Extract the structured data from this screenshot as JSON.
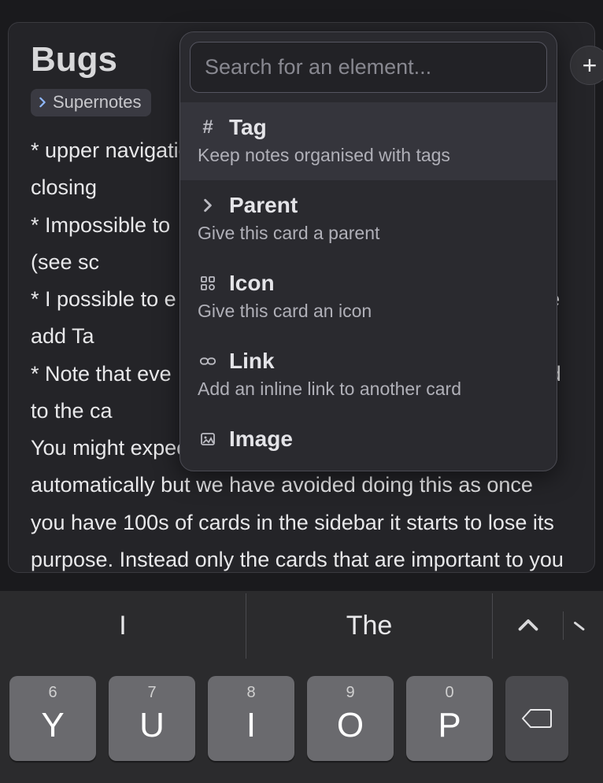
{
  "card": {
    "title": "Bugs",
    "parent_chip": "Supernotes",
    "body": "* upper navigation stops working when opening and closing\n* Impossible to                                              OS-iPadOS (see sc\n* I possible to e                                            d on iOS: the add Ta\n* Note that eve                                             will be added to the ca                                           any child cards to it.\nYou might expect all your cards to be indexed automatically but we have avoided doing this as once you have 100s of cards in the sidebar it starts to lose its purpose. Instead only the cards that are important to you should be in your card"
  },
  "popover": {
    "placeholder": "Search for an element...",
    "items": [
      {
        "title": "Tag",
        "desc": "Keep notes organised with tags",
        "icon": "hash"
      },
      {
        "title": "Parent",
        "desc": "Give this card a parent",
        "icon": "chevron"
      },
      {
        "title": "Icon",
        "desc": "Give this card an icon",
        "icon": "grid"
      },
      {
        "title": "Link",
        "desc": "Add an inline link to another card",
        "icon": "link"
      },
      {
        "title": "Image",
        "desc": "",
        "icon": "image"
      }
    ]
  },
  "keyboard": {
    "suggestions": [
      "I",
      "The"
    ],
    "keys": [
      {
        "num": "6",
        "ltr": "Y"
      },
      {
        "num": "7",
        "ltr": "U"
      },
      {
        "num": "8",
        "ltr": "I"
      },
      {
        "num": "9",
        "ltr": "O"
      },
      {
        "num": "0",
        "ltr": "P"
      }
    ]
  }
}
